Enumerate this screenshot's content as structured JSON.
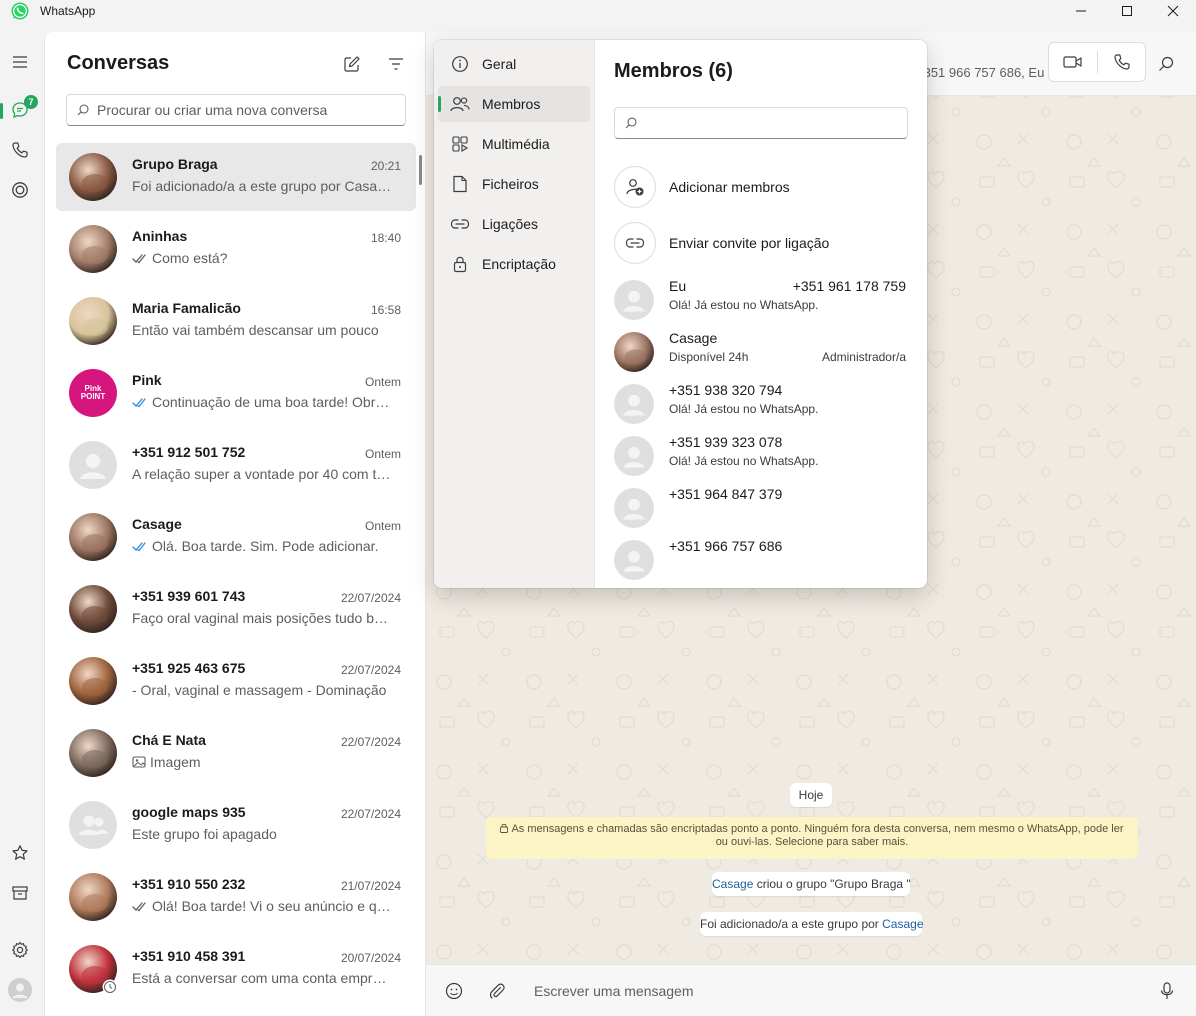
{
  "app": {
    "title": "WhatsApp",
    "accent": "#25a55f"
  },
  "rail": {
    "items": [
      {
        "name": "menu",
        "icon": "hamburger-icon"
      },
      {
        "name": "chats",
        "icon": "chat-icon",
        "badge": "7"
      },
      {
        "name": "calls",
        "icon": "phone-icon"
      },
      {
        "name": "status",
        "icon": "status-icon"
      },
      {
        "name": "starred",
        "icon": "star-icon"
      },
      {
        "name": "archived",
        "icon": "archive-icon"
      },
      {
        "name": "settings",
        "icon": "gear-icon"
      },
      {
        "name": "profile",
        "icon": "avatar"
      }
    ]
  },
  "chatlist": {
    "title": "Conversas",
    "search_placeholder": "Procurar ou criar uma nova conversa",
    "chats": [
      {
        "name": "Grupo Braga",
        "time": "20:21",
        "preview": "Foi adicionado/a a este grupo por Casage",
        "tick": "",
        "selected": true,
        "avatar_color": "#8a5a44"
      },
      {
        "name": "Aninhas",
        "time": "18:40",
        "preview": "Como está?",
        "tick": "grey",
        "avatar_color": "#a37e6a"
      },
      {
        "name": "Maria Famalicão",
        "time": "16:58",
        "preview": "Então vai também descansar um pouco",
        "tick": "",
        "avatar_color": "#d7c59b"
      },
      {
        "name": "Pink",
        "time": "Ontem",
        "preview": "Continuação de uma boa tarde! Obrigada",
        "tick": "blue",
        "avatar_color": "#d6157e",
        "avatar_text": "Pink POINT"
      },
      {
        "name": "+351 912 501 752",
        "time": "Ontem",
        "preview": "A relação super a vontade por 40 com tudo",
        "tick": "",
        "avatar_color": "#dfdfdf",
        "default": true
      },
      {
        "name": "Casage",
        "time": "Ontem",
        "preview": "Olá. Boa tarde. Sim. Pode adicionar.",
        "tick": "blue",
        "avatar_color": "#9c7563"
      },
      {
        "name": "+351 939 601 743",
        "time": "22/07/2024",
        "preview": "Faço oral vaginal mais posições tudo bem",
        "tick": "",
        "avatar_color": "#6e4a3a"
      },
      {
        "name": "+351 925 463 675",
        "time": "22/07/2024",
        "preview": "- Oral, vaginal e massagem  - Dominação",
        "tick": "",
        "avatar_color": "#a0643e"
      },
      {
        "name": "Chá E Nata",
        "time": "22/07/2024",
        "preview": "Imagem",
        "tick": "",
        "image_icon": true,
        "avatar_color": "#7e6a5e"
      },
      {
        "name": "google maps 935",
        "time": "22/07/2024",
        "preview": "Este grupo foi apagado",
        "tick": "",
        "avatar_color": "#dfdfdf",
        "default_group": true
      },
      {
        "name": "+351 910 550 232",
        "time": "21/07/2024",
        "preview": "Olá! Boa tarde! Vi o seu anúncio e queria",
        "tick": "grey",
        "avatar_color": "#b07c5d"
      },
      {
        "name": "+351 910 458 391",
        "time": "20/07/2024",
        "preview": "Está a conversar com uma conta empresarial",
        "tick": "",
        "avatar_color": "#c0323d"
      }
    ]
  },
  "chat": {
    "header_subtitle": "+351 966 757 686, Eu",
    "date_pill": "Hoje",
    "encryption_notice": "As mensagens e chamadas são encriptadas ponto a ponto. Ninguém fora desta conversa, nem mesmo o WhatsApp, pode ler ou ouvi-las. Selecione para saber mais.",
    "system1_link": "Casage",
    "system1_text": " criou o grupo \"Grupo Braga \"",
    "system2_text": "Foi adicionado/a a este grupo por ",
    "system2_link": "Casage",
    "composer_placeholder": "Escrever uma mensagem"
  },
  "popup": {
    "nav": [
      {
        "label": "Geral",
        "icon": "info-icon"
      },
      {
        "label": "Membros",
        "icon": "people-icon",
        "active": true
      },
      {
        "label": "Multimédia",
        "icon": "media-icon"
      },
      {
        "label": "Ficheiros",
        "icon": "file-icon"
      },
      {
        "label": "Ligações",
        "icon": "link-icon"
      },
      {
        "label": "Encriptação",
        "icon": "lock-icon"
      }
    ],
    "members_title": "Membros (6)",
    "search_placeholder": "",
    "add_members": "Adicionar membros",
    "invite_link": "Enviar convite por ligação",
    "members": [
      {
        "name": "Eu",
        "phone": "+351 961 178 759",
        "status": "Olá! Já estou no WhatsApp.",
        "role": ""
      },
      {
        "name": "Casage",
        "phone": "",
        "status": "Disponível 24h",
        "role": "Administrador/a",
        "photo": true
      },
      {
        "name": "+351 938 320 794",
        "phone": "",
        "status": "Olá! Já estou no WhatsApp.",
        "role": ""
      },
      {
        "name": "+351 939 323 078",
        "phone": "",
        "status": "Olá! Já estou no WhatsApp.",
        "role": ""
      },
      {
        "name": "+351 964 847 379",
        "phone": "",
        "status": "",
        "role": ""
      },
      {
        "name": "+351 966 757 686",
        "phone": "",
        "status": "",
        "role": ""
      }
    ]
  }
}
